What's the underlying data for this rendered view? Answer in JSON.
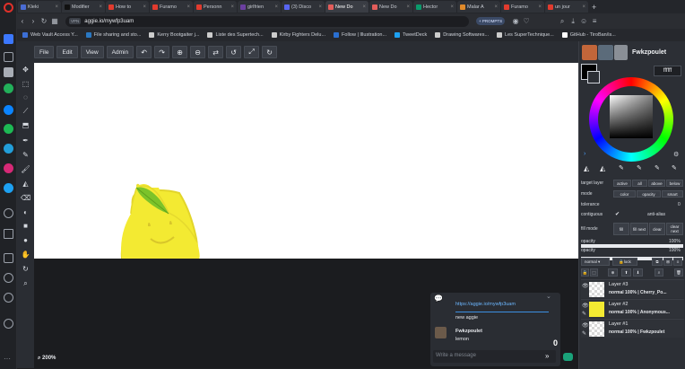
{
  "browser": {
    "tabs": [
      {
        "label": "Kleki",
        "color": "#4a6cd4"
      },
      {
        "label": "Modifier",
        "color": "#111111"
      },
      {
        "label": "How to",
        "color": "#e23b2e"
      },
      {
        "label": "Furamo",
        "color": "#e23b2e"
      },
      {
        "label": "Personn",
        "color": "#e23b2e"
      },
      {
        "label": "girlfrien",
        "color": "#6b3fa0"
      },
      {
        "label": "(3) Disco",
        "color": "#5865f2"
      },
      {
        "label": "New Do",
        "color": "#e35d5b"
      },
      {
        "label": "New Do",
        "color": "#e35d5b"
      },
      {
        "label": "Hector",
        "color": "#0a9a6b"
      },
      {
        "label": "Malar A",
        "color": "#e08a2a"
      },
      {
        "label": "Furamo",
        "color": "#e23b2e"
      },
      {
        "label": "un jour",
        "color": "#e23b2e"
      }
    ],
    "active_tab_index": 7,
    "vpn_label": "VPN",
    "url": "aggie.io/mywfp3uam",
    "prompts_label": "+ PROMPTS",
    "bookmarks": [
      {
        "label": "Web Vault Access Y...",
        "color": "#3c6fd6"
      },
      {
        "label": "File sharing and sto...",
        "color": "#2a78c2"
      },
      {
        "label": "Kerry Bootgaiter j...",
        "color": "#cccccc"
      },
      {
        "label": "Liste des Supertech...",
        "color": "#cccccc"
      },
      {
        "label": "Kirby Fighters Delu...",
        "color": "#cccccc"
      },
      {
        "label": "Follow | Illustration...",
        "color": "#2a6fd1"
      },
      {
        "label": "TweetDeck",
        "color": "#1da1f2"
      },
      {
        "label": "Drawing Softwares...",
        "color": "#cccccc"
      },
      {
        "label": "Les SuperTechnique...",
        "color": "#cccccc"
      },
      {
        "label": "GitHub - TiroBan/is...",
        "color": "#ffffff"
      }
    ]
  },
  "app": {
    "menu": [
      "File",
      "Edit",
      "View",
      "Admin"
    ],
    "zoom_label": "200%",
    "user_name": "Fwkzpoulet",
    "hex_value": "ffffff",
    "settings": {
      "target_layer_label": "target layer",
      "target_options": [
        "active",
        "all",
        "above",
        "below"
      ],
      "mode_label": "mode",
      "mode_options": [
        "color",
        "opacity",
        "smart"
      ],
      "tolerance_label": "tolerance",
      "tolerance_value": "0",
      "contiguous_label": "contiguous",
      "antialias_label": "anti-alias",
      "fill_mode_label": "fill mode",
      "fill_options": [
        "fill",
        "fill next",
        "clear",
        "clear next"
      ],
      "opacity_label": "opacity",
      "opacity_value": "100%",
      "opacity_level": 1.0,
      "opacity2_label": "opacity",
      "opacity2_value": "100%",
      "opacity2_level": 1.0,
      "blend_mode": "normal",
      "lock_label": "lock"
    },
    "layers": [
      {
        "name": "Layer #3",
        "meta": "normal 100% | Cherry_Po..."
      },
      {
        "name": "Layer #2",
        "meta": "normal 100% | Anonymous..."
      },
      {
        "name": "Layer #1",
        "meta": "normal 100% | Fwkzpoulet"
      }
    ],
    "chat": {
      "link": "https://aggie.io/mywfp3uam",
      "message1": "new aggie",
      "author": "Fwkzpoulet",
      "message2": "lemon",
      "counter": "0",
      "input_placeholder": "Write a message"
    }
  }
}
